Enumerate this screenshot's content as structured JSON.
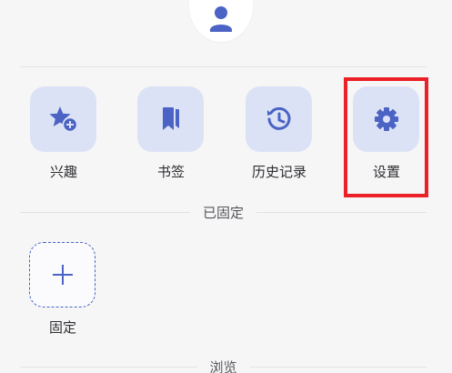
{
  "colors": {
    "background": "#f6f6f7",
    "tile_background": "#dce2f6",
    "icon_blue": "#4a63c4",
    "highlight_red": "#ec2127",
    "divider": "#e3e3e6"
  },
  "profile": {
    "icon": "person-icon"
  },
  "quick_actions": [
    {
      "label": "兴趣",
      "icon": "star-add-icon"
    },
    {
      "label": "书签",
      "icon": "bookmark-icon"
    },
    {
      "label": "历史记录",
      "icon": "history-icon"
    },
    {
      "label": "设置",
      "icon": "gear-icon"
    }
  ],
  "pinned_section": {
    "title": "已固定",
    "add_button_label": "固定",
    "add_icon": "plus-icon"
  },
  "browse_section": {
    "title": "浏览"
  }
}
